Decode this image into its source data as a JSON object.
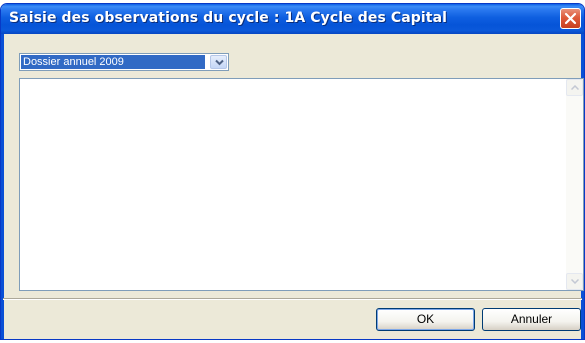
{
  "window": {
    "title": "Saisie des observations du cycle : 1A Cycle des Capital"
  },
  "dossier_select": {
    "selected": "Dossier annuel 2009"
  },
  "observations": {
    "value": ""
  },
  "buttons": {
    "ok": "OK",
    "cancel": "Annuler"
  },
  "icons": {
    "close": "close-icon",
    "dropdown": "chevron-down-icon",
    "scroll_up": "arrow-up-icon",
    "scroll_down": "arrow-down-icon"
  },
  "colors": {
    "titlebar": "#0a5fe6",
    "close_button": "#de5a3a",
    "selection": "#316ac5",
    "dialog_background": "#ece9d8"
  }
}
